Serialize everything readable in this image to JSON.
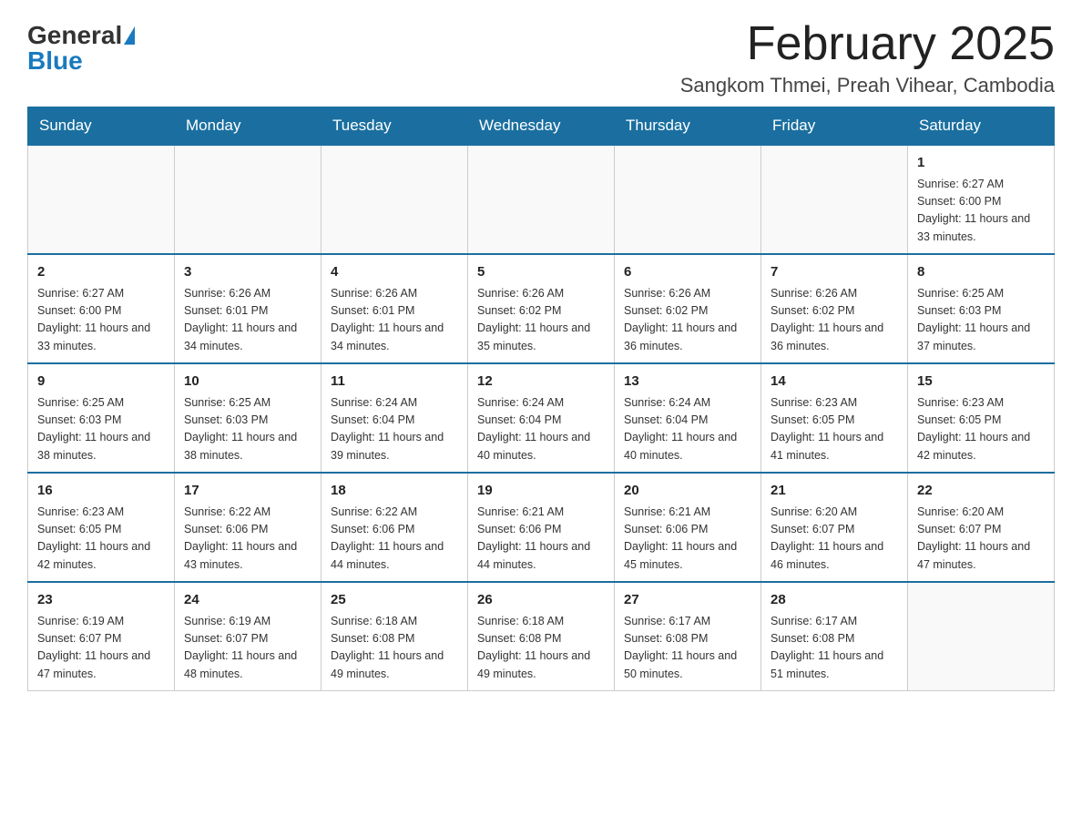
{
  "header": {
    "logo_general": "General",
    "logo_blue": "Blue",
    "month_title": "February 2025",
    "location": "Sangkom Thmei, Preah Vihear, Cambodia"
  },
  "weekdays": [
    "Sunday",
    "Monday",
    "Tuesday",
    "Wednesday",
    "Thursday",
    "Friday",
    "Saturday"
  ],
  "weeks": [
    [
      {
        "day": "",
        "info": ""
      },
      {
        "day": "",
        "info": ""
      },
      {
        "day": "",
        "info": ""
      },
      {
        "day": "",
        "info": ""
      },
      {
        "day": "",
        "info": ""
      },
      {
        "day": "",
        "info": ""
      },
      {
        "day": "1",
        "info": "Sunrise: 6:27 AM\nSunset: 6:00 PM\nDaylight: 11 hours\nand 33 minutes."
      }
    ],
    [
      {
        "day": "2",
        "info": "Sunrise: 6:27 AM\nSunset: 6:00 PM\nDaylight: 11 hours\nand 33 minutes."
      },
      {
        "day": "3",
        "info": "Sunrise: 6:26 AM\nSunset: 6:01 PM\nDaylight: 11 hours\nand 34 minutes."
      },
      {
        "day": "4",
        "info": "Sunrise: 6:26 AM\nSunset: 6:01 PM\nDaylight: 11 hours\nand 34 minutes."
      },
      {
        "day": "5",
        "info": "Sunrise: 6:26 AM\nSunset: 6:02 PM\nDaylight: 11 hours\nand 35 minutes."
      },
      {
        "day": "6",
        "info": "Sunrise: 6:26 AM\nSunset: 6:02 PM\nDaylight: 11 hours\nand 36 minutes."
      },
      {
        "day": "7",
        "info": "Sunrise: 6:26 AM\nSunset: 6:02 PM\nDaylight: 11 hours\nand 36 minutes."
      },
      {
        "day": "8",
        "info": "Sunrise: 6:25 AM\nSunset: 6:03 PM\nDaylight: 11 hours\nand 37 minutes."
      }
    ],
    [
      {
        "day": "9",
        "info": "Sunrise: 6:25 AM\nSunset: 6:03 PM\nDaylight: 11 hours\nand 38 minutes."
      },
      {
        "day": "10",
        "info": "Sunrise: 6:25 AM\nSunset: 6:03 PM\nDaylight: 11 hours\nand 38 minutes."
      },
      {
        "day": "11",
        "info": "Sunrise: 6:24 AM\nSunset: 6:04 PM\nDaylight: 11 hours\nand 39 minutes."
      },
      {
        "day": "12",
        "info": "Sunrise: 6:24 AM\nSunset: 6:04 PM\nDaylight: 11 hours\nand 40 minutes."
      },
      {
        "day": "13",
        "info": "Sunrise: 6:24 AM\nSunset: 6:04 PM\nDaylight: 11 hours\nand 40 minutes."
      },
      {
        "day": "14",
        "info": "Sunrise: 6:23 AM\nSunset: 6:05 PM\nDaylight: 11 hours\nand 41 minutes."
      },
      {
        "day": "15",
        "info": "Sunrise: 6:23 AM\nSunset: 6:05 PM\nDaylight: 11 hours\nand 42 minutes."
      }
    ],
    [
      {
        "day": "16",
        "info": "Sunrise: 6:23 AM\nSunset: 6:05 PM\nDaylight: 11 hours\nand 42 minutes."
      },
      {
        "day": "17",
        "info": "Sunrise: 6:22 AM\nSunset: 6:06 PM\nDaylight: 11 hours\nand 43 minutes."
      },
      {
        "day": "18",
        "info": "Sunrise: 6:22 AM\nSunset: 6:06 PM\nDaylight: 11 hours\nand 44 minutes."
      },
      {
        "day": "19",
        "info": "Sunrise: 6:21 AM\nSunset: 6:06 PM\nDaylight: 11 hours\nand 44 minutes."
      },
      {
        "day": "20",
        "info": "Sunrise: 6:21 AM\nSunset: 6:06 PM\nDaylight: 11 hours\nand 45 minutes."
      },
      {
        "day": "21",
        "info": "Sunrise: 6:20 AM\nSunset: 6:07 PM\nDaylight: 11 hours\nand 46 minutes."
      },
      {
        "day": "22",
        "info": "Sunrise: 6:20 AM\nSunset: 6:07 PM\nDaylight: 11 hours\nand 47 minutes."
      }
    ],
    [
      {
        "day": "23",
        "info": "Sunrise: 6:19 AM\nSunset: 6:07 PM\nDaylight: 11 hours\nand 47 minutes."
      },
      {
        "day": "24",
        "info": "Sunrise: 6:19 AM\nSunset: 6:07 PM\nDaylight: 11 hours\nand 48 minutes."
      },
      {
        "day": "25",
        "info": "Sunrise: 6:18 AM\nSunset: 6:08 PM\nDaylight: 11 hours\nand 49 minutes."
      },
      {
        "day": "26",
        "info": "Sunrise: 6:18 AM\nSunset: 6:08 PM\nDaylight: 11 hours\nand 49 minutes."
      },
      {
        "day": "27",
        "info": "Sunrise: 6:17 AM\nSunset: 6:08 PM\nDaylight: 11 hours\nand 50 minutes."
      },
      {
        "day": "28",
        "info": "Sunrise: 6:17 AM\nSunset: 6:08 PM\nDaylight: 11 hours\nand 51 minutes."
      },
      {
        "day": "",
        "info": ""
      }
    ]
  ]
}
